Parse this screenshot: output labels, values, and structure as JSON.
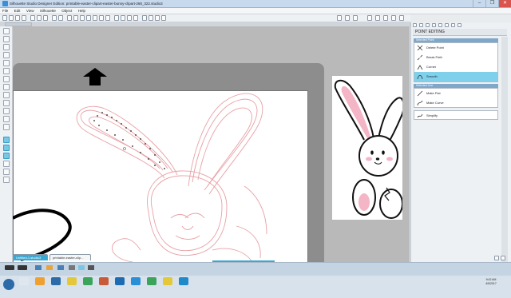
{
  "window": {
    "title": "Silhouette Studio Designer Edition: printable-easter-clipart-easter-bunny-clipart-268_322.studio3",
    "minimize": "–",
    "maximize": "❐",
    "close": "✕"
  },
  "menu": [
    "File",
    "Edit",
    "View",
    "Silhouette",
    "Object",
    "Help"
  ],
  "panel": {
    "title": "POINT EDITING",
    "selected_point_header": "Selected Point",
    "selected_point_items": [
      {
        "label": "Delete Point",
        "icon": "delete-point-icon",
        "selected": false
      },
      {
        "label": "Break Path",
        "icon": "break-path-icon",
        "selected": false
      },
      {
        "label": "Corner",
        "icon": "corner-icon",
        "selected": false
      },
      {
        "label": "Smooth",
        "icon": "smooth-icon",
        "selected": true
      }
    ],
    "selected_line_header": "Selected Line",
    "selected_line_items": [
      {
        "label": "Make Flat",
        "icon": "make-flat-icon"
      },
      {
        "label": "Make Curve",
        "icon": "make-curve-icon"
      }
    ],
    "simplify": "Simplify"
  },
  "tabs": {
    "active": "Untitled-1.studio3",
    "other": "printable-easter-clip..."
  },
  "clock": {
    "time": "9:42 AM",
    "date": "4/5/2017"
  },
  "colors": {
    "accent": "#3aa8d3",
    "selected_item": "#7fd0ea",
    "cut_line": "#e8a0a6"
  }
}
